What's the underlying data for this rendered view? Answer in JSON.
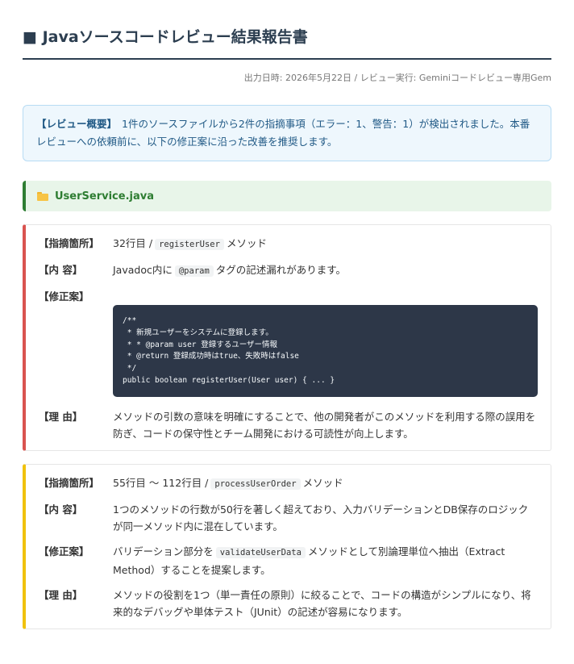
{
  "header": {
    "title": "■ Javaソースコードレビュー結果報告書",
    "meta": "出力日時: 2026年5月22日 / レビュー実行: Geminiコードレビュー専用Gem"
  },
  "summary": {
    "lead": "【レビュー概要】",
    "text": "1件のソースファイルから2件の指摘事項（エラー：1、警告：1）が検出されました。本番レビューへの依頼前に、以下の修正案に沿った改善を推奨します。"
  },
  "file": {
    "icon": "folder-icon",
    "name": "UserService.java"
  },
  "labels": {
    "location": "【指摘箇所】",
    "content": "【内 容】",
    "fix": "【修正案】",
    "reason": "【理 由】"
  },
  "issues": [
    {
      "severity": "error",
      "accent": "#d9534f",
      "location_prefix": "32行目 /",
      "location_code": "registerUser",
      "location_suffix": "メソッド",
      "content_prefix": "Javadoc内に",
      "content_code": "@param",
      "content_suffix": "タグの記述漏れがあります。",
      "fix_code": "/**\n * 新規ユーザーをシステムに登録します。\n * * @param user 登録するユーザー情報\n * @return 登録成功時はtrue、失敗時はfalse\n */\npublic boolean registerUser(User user) { ... }",
      "reason": "メソッドの引数の意味を明確にすることで、他の開発者がこのメソッドを利用する際の誤用を防ぎ、コードの保守性とチーム開発における可読性が向上します。"
    },
    {
      "severity": "warning",
      "accent": "#f0c20c",
      "location_prefix": "55行目 〜 112行目 /",
      "location_code": "processUserOrder",
      "location_suffix": "メソッド",
      "content": "1つのメソッドの行数が50行を著しく超えており、入力バリデーションとDB保存のロジックが同一メソッド内に混在しています。",
      "fix_prefix": "バリデーション部分を",
      "fix_code_inline": "validateUserData",
      "fix_suffix": "メソッドとして別論理単位へ抽出（Extract Method）することを提案します。",
      "reason": "メソッドの役割を1つ（単一責任の原則）に絞ることで、コードの構造がシンプルになり、将来的なデバッグや単体テスト（JUnit）の記述が容易になります。"
    }
  ]
}
